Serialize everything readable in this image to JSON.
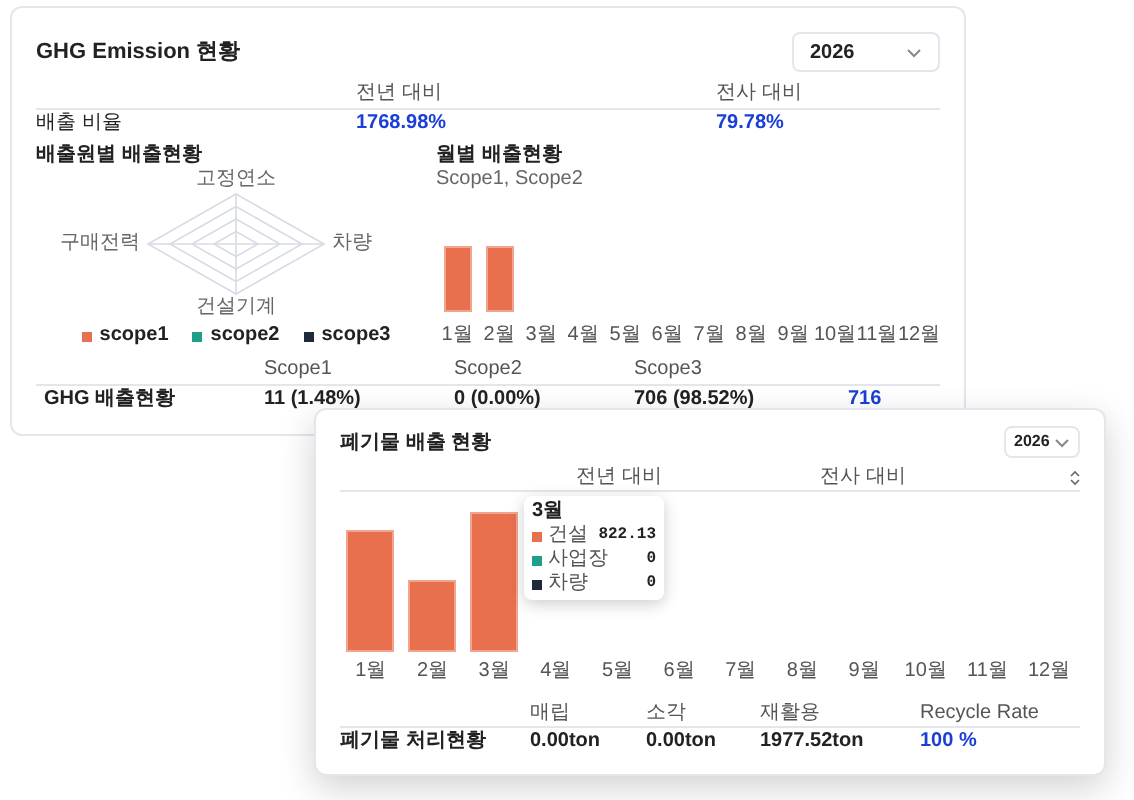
{
  "ghg_card": {
    "title": "GHG Emission 현황",
    "year_select": {
      "value": "2026"
    },
    "comparison": {
      "columns": [
        "전년 대비",
        "전사 대비"
      ],
      "row": {
        "label": "배출 비율",
        "values": [
          "1768.98%",
          "79.78%"
        ]
      }
    },
    "source_section": {
      "title": "배출원별 배출현황",
      "radar_labels": [
        "고정연소",
        "차량",
        "건설기계",
        "구매전력"
      ],
      "legend": [
        {
          "label": "scope1",
          "color": "#e8704f"
        },
        {
          "label": "scope2",
          "color": "#1f9e89"
        },
        {
          "label": "scope3",
          "color": "#1e2a3a"
        }
      ]
    },
    "monthly_section": {
      "title": "월별 배출현황",
      "subtitle": "Scope1, Scope2",
      "months": [
        "1월",
        "2월",
        "3월",
        "4월",
        "5월",
        "6월",
        "7월",
        "8월",
        "9월",
        "10월",
        "11월",
        "12월"
      ]
    },
    "summary": {
      "columns": [
        "Scope1",
        "Scope2",
        "Scope3"
      ],
      "row": {
        "label": "GHG 배출현황",
        "values": [
          "11 (1.48%)",
          "0 (0.00%)",
          "706 (98.52%)"
        ],
        "total": "716"
      }
    }
  },
  "waste_card": {
    "title": "폐기물 배출 현황",
    "year_select": {
      "value": "2026"
    },
    "comparison": {
      "columns": [
        "전년 대비",
        "전사 대비"
      ]
    },
    "months": [
      "1월",
      "2월",
      "3월",
      "4월",
      "5월",
      "6월",
      "7월",
      "8월",
      "9월",
      "10월",
      "11월",
      "12월"
    ],
    "tooltip": {
      "title": "3월",
      "items": [
        {
          "label": "건설",
          "value": "822.13",
          "color": "#e8704f"
        },
        {
          "label": "사업장",
          "value": "0",
          "color": "#1f9e89"
        },
        {
          "label": "차량",
          "value": "0",
          "color": "#1e2a3a"
        }
      ]
    },
    "summary": {
      "columns": [
        "매립",
        "소각",
        "재활용",
        "Recycle Rate"
      ],
      "row": {
        "label": "폐기물 처리현황",
        "values": [
          "0.00ton",
          "0.00ton",
          "1977.52ton",
          "100 %"
        ]
      }
    }
  }
}
